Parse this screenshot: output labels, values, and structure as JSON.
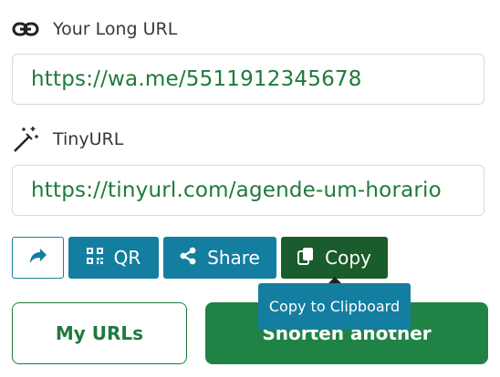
{
  "long_url": {
    "label": "Your Long URL",
    "value": "https://wa.me/5511912345678",
    "icon": "link-icon"
  },
  "tiny_url": {
    "label": "TinyURL",
    "value": "https://tinyurl.com/agende-um-horario",
    "icon": "magic-wand-icon"
  },
  "actions": {
    "redirect_icon": "share-arrow-icon",
    "qr_label": "QR",
    "share_label": "Share",
    "copy_label": "Copy",
    "copy_tooltip": "Copy to Clipboard"
  },
  "footer": {
    "my_urls_label": "My URLs",
    "shorten_another_label": "Shorten another"
  },
  "colors": {
    "accent_green": "#1f8346",
    "dark_green": "#1a5c2b",
    "teal": "#137ea0",
    "url_text": "#1f7a3c"
  }
}
